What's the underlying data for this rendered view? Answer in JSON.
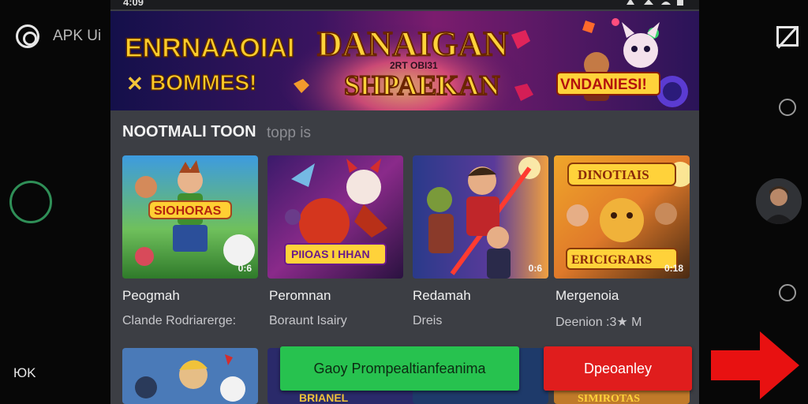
{
  "colors": {
    "screen_bg": "#3c3e44",
    "primary_green": "#27c24f",
    "danger_red": "#e01d1d",
    "arrow_red": "#e81111",
    "ring_green": "#2f8f57"
  },
  "left_rail": {
    "app_label": "APK Ui",
    "count": "ЮK"
  },
  "status_bar": {
    "time": "4:09"
  },
  "banner": {
    "left_title": "ENRNAAOIAI",
    "left_subtitle": "BOMMES!",
    "center_title": "DANAIGAN",
    "center_small": "2RT OBI31",
    "center_bottom": "SHPAEKAN",
    "right_tag": "VNDANIESI!"
  },
  "section": {
    "title": "NOOTMALI TOON",
    "subtitle": "topp is"
  },
  "cards": [
    {
      "art_label": "SIOHORAS",
      "badge": "0:6",
      "title": "Peogmah",
      "subtitle": "Clande Rodriarerge:"
    },
    {
      "art_label": "PIIOAS I HHAN",
      "badge": "",
      "title": "Peromnan",
      "subtitle": "Boraunt Isairy"
    },
    {
      "art_label": "",
      "badge": "0:6",
      "title": "Redamah",
      "subtitle": "Dreis"
    },
    {
      "art_label": "DINOTIAIS",
      "art_label_bottom": "ERICIGRARS",
      "badge": "0:18",
      "title": "Mergenoia",
      "subtitle": "Deenion :3★ M"
    }
  ],
  "buttons": {
    "primary": "Gaoy Prompealtianfeanima",
    "secondary": "Dpeoanley"
  },
  "bottom_card_label": "BRIANEL",
  "bottom_right_card_label": "SIMIROTAS"
}
